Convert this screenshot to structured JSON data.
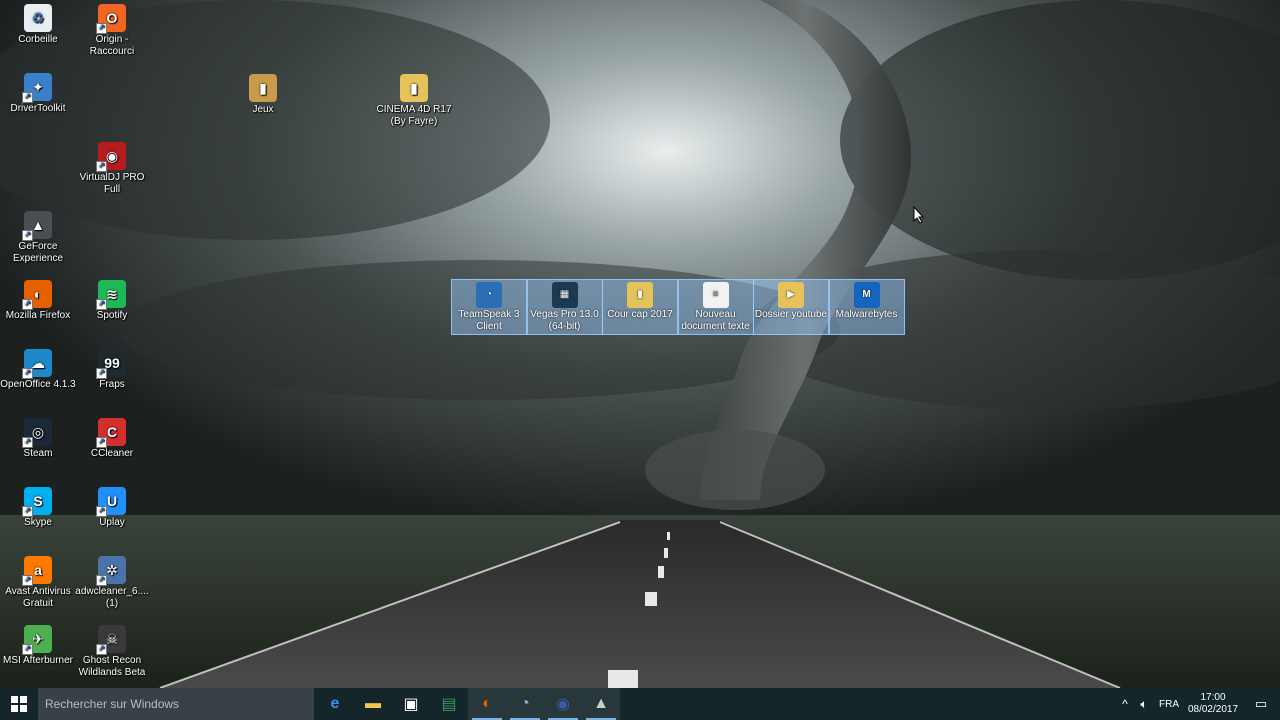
{
  "desktop": {
    "icons": [
      {
        "name": "recycle-bin",
        "label": "Corbeille",
        "bg": "#e8eef2",
        "glyph": "♻"
      },
      {
        "name": "origin-shortcut",
        "label": "Origin - Raccourci",
        "bg": "#f26522",
        "glyph": "O"
      },
      {
        "name": "drivertoolkit",
        "label": "DriverToolkit",
        "bg": "#3c7fc9",
        "glyph": "✦"
      },
      {
        "name": "virtualdj",
        "label": "VirtualDJ PRO Full",
        "bg": "#b71c1c",
        "glyph": "◉"
      },
      {
        "name": "geforce-experience",
        "label": "GeForce Experience",
        "bg": "#4a4f52",
        "glyph": "▲"
      },
      {
        "name": "firefox",
        "label": "Mozilla Firefox",
        "bg": "#e66000",
        "glyph": "◐"
      },
      {
        "name": "spotify",
        "label": "Spotify",
        "bg": "#1db954",
        "glyph": "≋"
      },
      {
        "name": "openoffice",
        "label": "OpenOffice 4.1.3",
        "bg": "#1e88c8",
        "glyph": "☁"
      },
      {
        "name": "fraps",
        "label": "Fraps",
        "bg": "#1e2a30",
        "glyph": "99"
      },
      {
        "name": "steam",
        "label": "Steam",
        "bg": "#1b2838",
        "glyph": "◎"
      },
      {
        "name": "ccleaner",
        "label": "CCleaner",
        "bg": "#d32f2f",
        "glyph": "C"
      },
      {
        "name": "skype",
        "label": "Skype",
        "bg": "#00aff0",
        "glyph": "S"
      },
      {
        "name": "uplay",
        "label": "Uplay",
        "bg": "#1e90ff",
        "glyph": "U"
      },
      {
        "name": "avast",
        "label": "Avast Antivirus Gratuit",
        "bg": "#ff7800",
        "glyph": "a"
      },
      {
        "name": "adwcleaner",
        "label": "adwcleaner_6.... (1)",
        "bg": "#4a73a8",
        "glyph": "✲"
      },
      {
        "name": "msi-afterburner",
        "label": "MSI Afterburner",
        "bg": "#4caf50",
        "glyph": "✈"
      },
      {
        "name": "ghost-recon",
        "label": "Ghost Recon Wildlands Beta",
        "bg": "#3a3a3a",
        "glyph": "☠"
      },
      {
        "name": "jeux-folder",
        "label": "Jeux",
        "bg": "#c89b4c",
        "glyph": "▮"
      },
      {
        "name": "cinema4d-folder",
        "label": "CINEMA 4D R17 (By Fayre)",
        "bg": "#e6c25a",
        "glyph": "▮"
      }
    ],
    "selected": [
      {
        "name": "teamspeak",
        "label": "TeamSpeak 3 Client",
        "bg": "#2a6fb5",
        "glyph": "◔"
      },
      {
        "name": "vegas-pro",
        "label": "Vegas Pro 13.0 (64-bit)",
        "bg": "#1b3a52",
        "glyph": "▦"
      },
      {
        "name": "cour-cap-folder",
        "label": "Cour cap 2017",
        "bg": "#e6c25a",
        "glyph": "▮"
      },
      {
        "name": "nouveau-document",
        "label": "Nouveau document texte",
        "bg": "#f2f2f2",
        "glyph": "≡"
      },
      {
        "name": "dossier-youtube",
        "label": "Dossier youtube",
        "bg": "#e6c25a",
        "glyph": "▶"
      },
      {
        "name": "malwarebytes",
        "label": "Malwarebytes",
        "bg": "#1565c0",
        "glyph": "M"
      }
    ]
  },
  "taskbar": {
    "search_placeholder": "Rechercher sur Windows",
    "apps": [
      {
        "name": "edge",
        "glyph": "e",
        "color": "#3c8ee6"
      },
      {
        "name": "file-explorer",
        "glyph": "▬",
        "color": "#f2c84b"
      },
      {
        "name": "store",
        "glyph": "▣",
        "color": "#ffffff"
      },
      {
        "name": "excel-like",
        "glyph": "▤",
        "color": "#2e9b5f"
      },
      {
        "name": "firefox",
        "glyph": "◐",
        "color": "#e66000"
      },
      {
        "name": "teamspeak",
        "glyph": "◔",
        "color": "#8fb7e0"
      },
      {
        "name": "cinema4d",
        "glyph": "◉",
        "color": "#3b5ba8"
      },
      {
        "name": "geforce",
        "glyph": "▲",
        "color": "#cccccc"
      }
    ],
    "language": "FRA",
    "time": "17:00",
    "date": "08/02/2017"
  }
}
